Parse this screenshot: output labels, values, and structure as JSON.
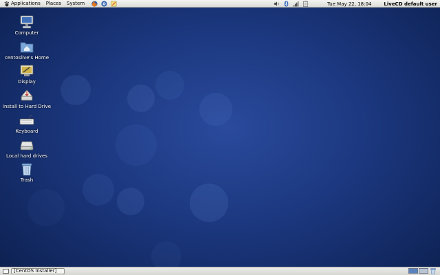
{
  "top_panel": {
    "menus": {
      "applications": "Applications",
      "places": "Places",
      "system": "System"
    },
    "launchers": [
      "firefox-icon",
      "evolution-icon",
      "notes-icon"
    ],
    "tray_icons": [
      "volume-icon",
      "bluetooth-icon",
      "network-signal-icon",
      "clipboard-icon"
    ],
    "clock": "Tue May 22, 18:04",
    "user": "LiveCD default user"
  },
  "desktop": {
    "icons": [
      {
        "label": "Computer",
        "icon": "computer-icon"
      },
      {
        "label": "centoslive's Home",
        "icon": "home-folder-icon"
      },
      {
        "label": "Display",
        "icon": "display-icon"
      },
      {
        "label": "Install to Hard Drive",
        "icon": "install-icon"
      },
      {
        "label": "Keyboard",
        "icon": "keyboard-icon"
      },
      {
        "label": "Local hard drives",
        "icon": "hard-drive-icon"
      },
      {
        "label": "Trash",
        "icon": "trash-icon"
      }
    ]
  },
  "bottom_panel": {
    "task": "[CentOS Installer]",
    "workspaces": 2,
    "active_workspace": 1
  },
  "colors": {
    "panel": "#e4e4e1",
    "desktop_center": "#2a4a9c",
    "desktop_edge": "#0b1a40"
  }
}
